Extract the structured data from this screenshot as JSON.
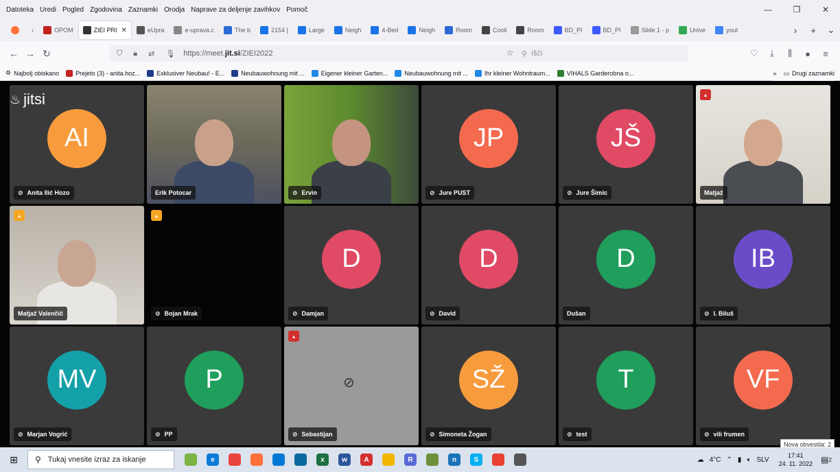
{
  "menu": [
    "Datoteka",
    "Uredi",
    "Pogled",
    "Zgodovina",
    "Zaznamki",
    "Orodja",
    "Naprave za deljenje zavihkov",
    "Pomoč"
  ],
  "tabs": [
    {
      "label": "OPOM",
      "color": "#c5221f"
    },
    {
      "label": "ZIEI PRI",
      "color": "#333333",
      "active": true
    },
    {
      "label": "eUpra",
      "color": "#555555"
    },
    {
      "label": "e-uprava.c",
      "color": "#888888"
    },
    {
      "label": "The b",
      "color": "#2d6ad6"
    },
    {
      "label": "2154 |",
      "color": "#1a73e8"
    },
    {
      "label": "Large",
      "color": "#1a73e8"
    },
    {
      "label": "Neigh",
      "color": "#1a73e8"
    },
    {
      "label": "4-Bed",
      "color": "#1a73e8"
    },
    {
      "label": "Neigh",
      "color": "#1a73e8"
    },
    {
      "label": "Room",
      "color": "#2d6ad6"
    },
    {
      "label": "Cooli",
      "color": "#444444"
    },
    {
      "label": "Room",
      "color": "#444444"
    },
    {
      "label": "BD_PI",
      "color": "#3d5afe"
    },
    {
      "label": "BD_PI",
      "color": "#3d5afe"
    },
    {
      "label": "Slide 1 - p",
      "color": "#999999"
    },
    {
      "label": "Unive",
      "color": "#34a853"
    },
    {
      "label": "yout",
      "color": "#4285f4"
    }
  ],
  "nav": {
    "url_prefix": "https://meet.",
    "url_domain": "jit.si",
    "url_suffix": "/ZIEI2022",
    "search_placeholder": "Išči"
  },
  "bookmarks": [
    {
      "label": "Najbolj obiskano",
      "color": "#666666"
    },
    {
      "label": "Prejeto (3) - anita.hoz...",
      "color": "#c5221f"
    },
    {
      "label": "Exklusiver Neubau! - E...",
      "color": "#1f3c88"
    },
    {
      "label": "Neubauwohnung mit ...",
      "color": "#1f3c88"
    },
    {
      "label": "Eigener kleiner Garten...",
      "color": "#1e88e5"
    },
    {
      "label": "Neubauwohnung mit ...",
      "color": "#1e88e5"
    },
    {
      "label": "Ihr kleiner Wohntraum...",
      "color": "#1e88e5"
    },
    {
      "label": "VIHALS Garderobna o...",
      "color": "#2e7d32"
    }
  ],
  "bookmarks_more": "Drugi zaznamki",
  "meeting": {
    "logo": "jitsi",
    "participants": [
      {
        "name": "Anita Ilić Hozo",
        "initials": "AI",
        "color": "#f89b3d",
        "muted": true,
        "type": "avatar"
      },
      {
        "name": "Erik Potocar",
        "type": "video",
        "muted": false
      },
      {
        "name": "Ervin",
        "type": "video",
        "muted": true
      },
      {
        "name": "Jure PUST",
        "initials": "JP",
        "color": "#f46a4f",
        "muted": true,
        "type": "avatar"
      },
      {
        "name": "Jure Šimic",
        "initials": "JŠ",
        "color": "#e04a64",
        "muted": true,
        "type": "avatar"
      },
      {
        "name": "Matjaž",
        "type": "video",
        "muted": false,
        "conn": "#d32f2f",
        "active": true
      },
      {
        "name": "Matjaž Valenčič",
        "type": "video",
        "muted": false,
        "conn": "#f5a623"
      },
      {
        "name": "Bojan Mrak",
        "type": "dark",
        "muted": true,
        "conn": "#f5a623"
      },
      {
        "name": "Damjan",
        "initials": "D",
        "color": "#e04a64",
        "muted": true,
        "type": "avatar"
      },
      {
        "name": "David",
        "initials": "D",
        "color": "#e04a64",
        "muted": true,
        "type": "avatar"
      },
      {
        "name": "Dušan",
        "initials": "D",
        "color": "#1f9e5c",
        "muted": false,
        "type": "avatar"
      },
      {
        "name": "I. Biluš",
        "initials": "IB",
        "color": "#6a4cc9",
        "muted": true,
        "type": "avatar"
      },
      {
        "name": "Marjan Vogrić",
        "initials": "MV",
        "color": "#14a0a8",
        "muted": true,
        "type": "avatar"
      },
      {
        "name": "PP",
        "initials": "P",
        "color": "#1f9e5c",
        "muted": true,
        "type": "avatar"
      },
      {
        "name": "Sebastijan",
        "type": "camoff",
        "muted": true,
        "conn": "#d32f2f"
      },
      {
        "name": "Simoneta Žogan",
        "initials": "SŽ",
        "color": "#f89b3d",
        "muted": true,
        "type": "avatar"
      },
      {
        "name": "test",
        "initials": "T",
        "color": "#1f9e5c",
        "muted": true,
        "type": "avatar"
      },
      {
        "name": "vili frumen",
        "initials": "VF",
        "color": "#f46a4f",
        "muted": true,
        "type": "avatar"
      }
    ]
  },
  "toast": "Nova obvestila: 2",
  "taskbar": {
    "search_placeholder": "Tukaj vnesite izraz za iskanje",
    "apps": [
      {
        "letter": "",
        "color": "#7cb342"
      },
      {
        "letter": "e",
        "color": "#0a7bd6"
      },
      {
        "letter": "",
        "color": "#e8453c"
      },
      {
        "letter": "",
        "color": "#ff7139"
      },
      {
        "letter": "",
        "color": "#0078d4"
      },
      {
        "letter": "",
        "color": "#0b6a9e"
      },
      {
        "letter": "x",
        "color": "#1d6f42"
      },
      {
        "letter": "w",
        "color": "#2b579a"
      },
      {
        "letter": "A",
        "color": "#d32f2f"
      },
      {
        "letter": "",
        "color": "#f2b700"
      },
      {
        "letter": "R",
        "color": "#5a6ad6"
      },
      {
        "letter": "",
        "color": "#6d8f3a"
      },
      {
        "letter": "n",
        "color": "#1a73b8"
      },
      {
        "letter": "S",
        "color": "#00aff0"
      },
      {
        "letter": "",
        "color": "#e94235"
      },
      {
        "letter": "",
        "color": "#555555"
      }
    ],
    "temperature": "4°C",
    "language": "SLV",
    "time": "17:41",
    "date": "24. 11. 2022",
    "notif_count": "2"
  }
}
